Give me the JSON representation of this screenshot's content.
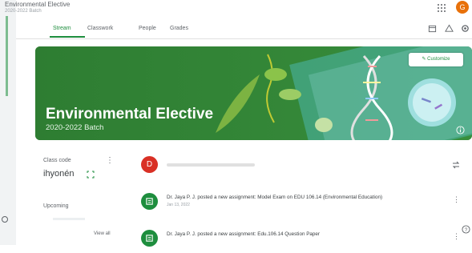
{
  "header": {
    "course_title": "Environmental Elective",
    "course_subtitle": "2020-2022 Batch",
    "avatar_letter": "G",
    "accent_color": "#1e8e3e"
  },
  "tabs": [
    {
      "label": "Stream",
      "active": true
    },
    {
      "label": "Classwork",
      "active": false
    },
    {
      "label": "People",
      "active": false
    },
    {
      "label": "Grades",
      "active": false
    }
  ],
  "tab_icons": [
    "calendar-icon",
    "drive-icon",
    "settings-icon"
  ],
  "banner": {
    "title": "Environmental Elective",
    "subtitle": "2020-2022 Batch",
    "customize_label": "Customize",
    "background_color": "#2e7d32"
  },
  "class_code": {
    "label": "Class code",
    "value": "ihyonén"
  },
  "upcoming": {
    "label": "Upcoming",
    "view_all": "View all"
  },
  "feed": [
    {
      "type": "announce",
      "avatar_letter": "D",
      "avatar_color": "#d93025"
    },
    {
      "type": "assignment",
      "avatar_color": "#1e8e3e",
      "text": "Dr. Jaya P. J. posted a new assignment: Model Exam on EDU 106.14 (Environmental Education)",
      "date": "Jan 13, 2022"
    },
    {
      "type": "assignment",
      "avatar_color": "#1e8e3e",
      "text": "Dr. Jaya P. J. posted a new assignment: Edu.106.14 Question Paper"
    }
  ]
}
